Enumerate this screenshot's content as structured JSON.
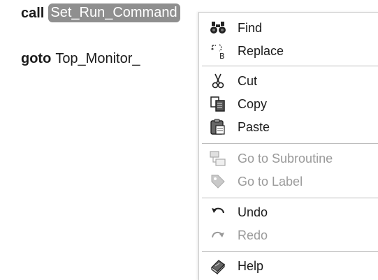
{
  "editor": {
    "line1": {
      "keyword": "call",
      "identifier": "Set_Run_Command"
    },
    "line2": {
      "keyword": "goto",
      "identifier": "Top_Monitor_"
    }
  },
  "context_menu": {
    "items": [
      {
        "label": "Find",
        "icon": "binoculars-icon",
        "enabled": true
      },
      {
        "label": "Replace",
        "icon": "replace-icon",
        "enabled": true
      },
      {
        "label": "Cut",
        "icon": "scissors-icon",
        "enabled": true
      },
      {
        "label": "Copy",
        "icon": "copy-icon",
        "enabled": true
      },
      {
        "label": "Paste",
        "icon": "clipboard-icon",
        "enabled": true
      },
      {
        "label": "Go to Subroutine",
        "icon": "subroutine-icon",
        "enabled": false
      },
      {
        "label": "Go to Label",
        "icon": "tag-icon",
        "enabled": false
      },
      {
        "label": "Undo",
        "icon": "undo-icon",
        "enabled": true
      },
      {
        "label": "Redo",
        "icon": "redo-icon",
        "enabled": false
      },
      {
        "label": "Help",
        "icon": "help-book-icon",
        "enabled": true
      }
    ]
  },
  "colors": {
    "selection_bg": "#8f8f8f",
    "disabled_text": "#9a9a9a",
    "divider": "#bdbdbd"
  }
}
